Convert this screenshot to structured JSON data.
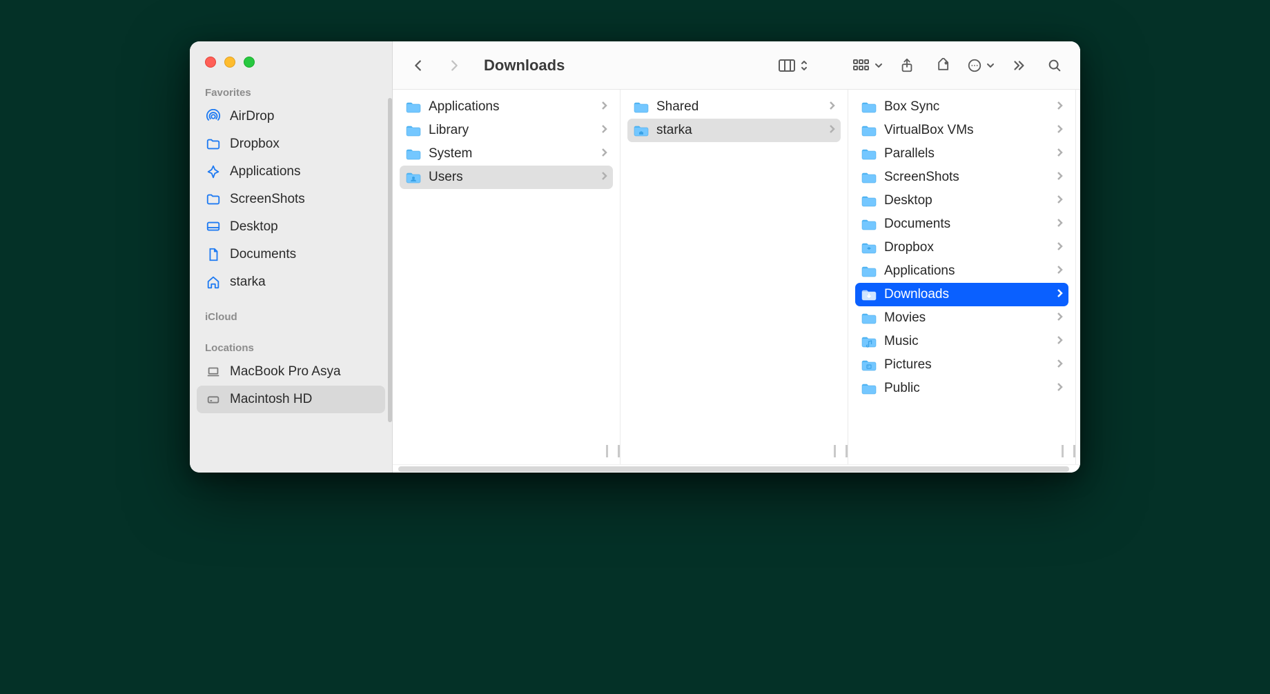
{
  "window": {
    "title": "Downloads"
  },
  "sidebar": {
    "sections": [
      {
        "header": "Favorites",
        "items": [
          {
            "label": "AirDrop",
            "icon": "airdrop",
            "selected": false
          },
          {
            "label": "Dropbox",
            "icon": "folder",
            "selected": false
          },
          {
            "label": "Applications",
            "icon": "apps",
            "selected": false
          },
          {
            "label": "ScreenShots",
            "icon": "folder",
            "selected": false
          },
          {
            "label": "Desktop",
            "icon": "desktop",
            "selected": false
          },
          {
            "label": "Documents",
            "icon": "document",
            "selected": false
          },
          {
            "label": "starka",
            "icon": "home",
            "selected": false
          }
        ]
      },
      {
        "header": "iCloud",
        "items": []
      },
      {
        "header": "Locations",
        "items": [
          {
            "label": "MacBook Pro Asya",
            "icon": "laptop",
            "selected": false,
            "gray": true
          },
          {
            "label": "Macintosh HD",
            "icon": "disk",
            "selected": true,
            "gray": true
          }
        ]
      }
    ]
  },
  "columns": [
    {
      "items": [
        {
          "label": "Applications",
          "icon": "folder",
          "has_children": true,
          "state": "normal"
        },
        {
          "label": "Library",
          "icon": "folder",
          "has_children": true,
          "state": "normal"
        },
        {
          "label": "System",
          "icon": "folder",
          "has_children": true,
          "state": "normal"
        },
        {
          "label": "Users",
          "icon": "folder-users",
          "has_children": true,
          "state": "path-selected"
        }
      ]
    },
    {
      "items": [
        {
          "label": "Shared",
          "icon": "folder",
          "has_children": true,
          "state": "normal"
        },
        {
          "label": "starka",
          "icon": "folder-home",
          "has_children": true,
          "state": "path-selected"
        }
      ]
    },
    {
      "items": [
        {
          "label": "Box Sync",
          "icon": "folder",
          "has_children": true,
          "state": "normal"
        },
        {
          "label": "VirtualBox VMs",
          "icon": "folder",
          "has_children": true,
          "state": "normal"
        },
        {
          "label": "Parallels",
          "icon": "folder",
          "has_children": true,
          "state": "normal"
        },
        {
          "label": "ScreenShots",
          "icon": "folder",
          "has_children": true,
          "state": "normal"
        },
        {
          "label": "Desktop",
          "icon": "folder",
          "has_children": true,
          "state": "normal"
        },
        {
          "label": "Documents",
          "icon": "folder",
          "has_children": true,
          "state": "normal"
        },
        {
          "label": "Dropbox",
          "icon": "folder-dropbox",
          "has_children": true,
          "state": "normal"
        },
        {
          "label": "Applications",
          "icon": "folder",
          "has_children": true,
          "state": "normal"
        },
        {
          "label": "Downloads",
          "icon": "folder-downloads",
          "has_children": true,
          "state": "active"
        },
        {
          "label": "Movies",
          "icon": "folder",
          "has_children": true,
          "state": "normal"
        },
        {
          "label": "Music",
          "icon": "folder-music",
          "has_children": true,
          "state": "normal"
        },
        {
          "label": "Pictures",
          "icon": "folder-pictures",
          "has_children": true,
          "state": "normal"
        },
        {
          "label": "Public",
          "icon": "folder",
          "has_children": true,
          "state": "normal"
        }
      ]
    }
  ]
}
